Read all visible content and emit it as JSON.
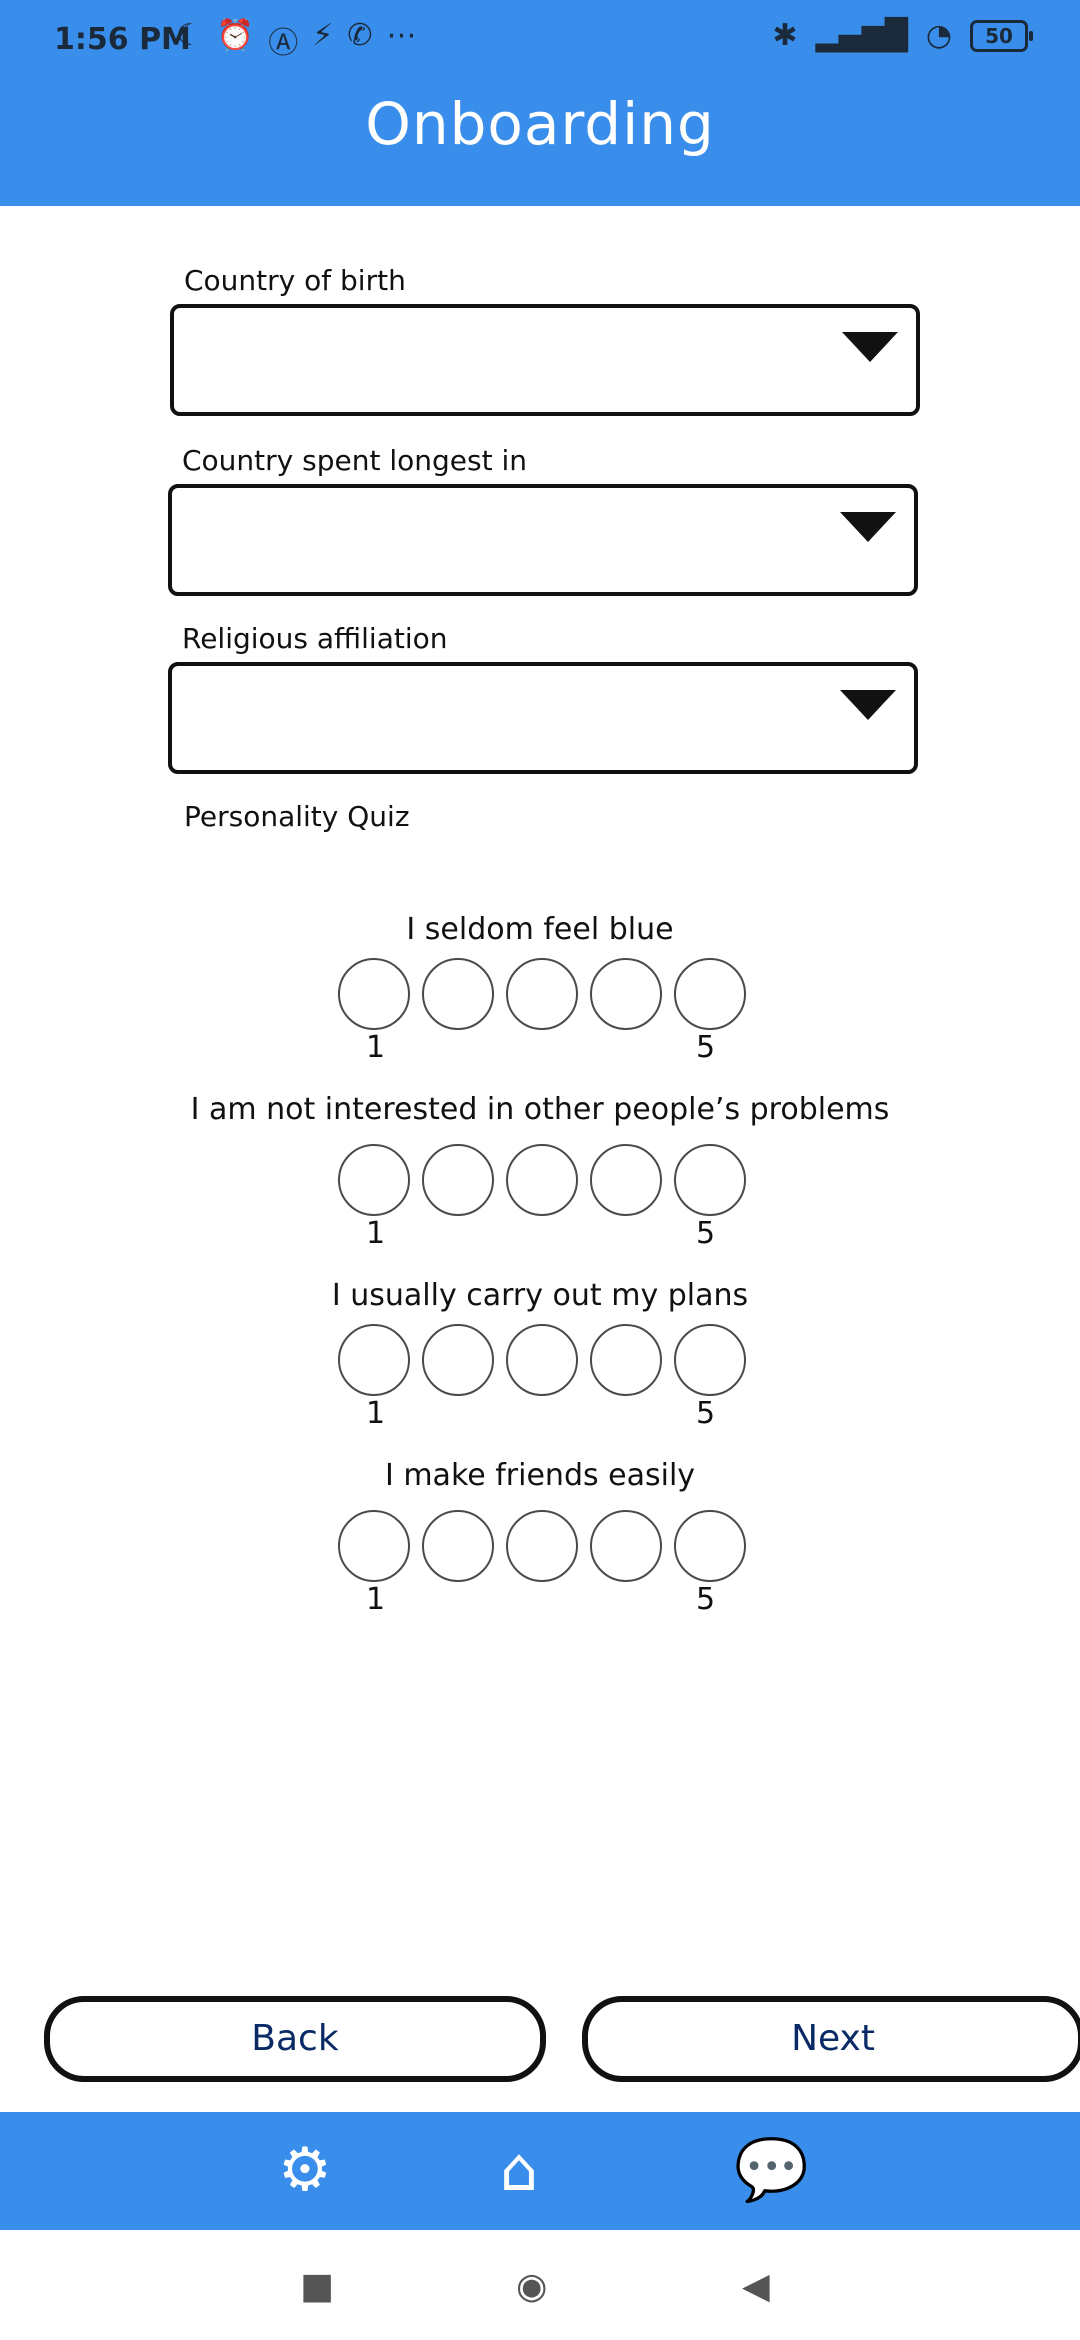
{
  "status_bar": {
    "time": "1:56 PM",
    "left_icons": [
      "moon-icon",
      "alarm-icon",
      "a-circle-icon",
      "hd-icon",
      "whatsapp-icon",
      "more-icon"
    ],
    "battery": "50"
  },
  "header": {
    "title": "Onboarding"
  },
  "form": {
    "country_of_birth_label": "Country of birth",
    "country_longest_label": "Country spent longest in",
    "religious_affiliation_label": "Religious affiliation"
  },
  "quiz": {
    "title": "Personality Quiz",
    "items": [
      {
        "question": "I seldom feel blue",
        "min_label": "1",
        "max_label": "5"
      },
      {
        "question": "I am not interested in other people’s problems",
        "min_label": "1",
        "max_label": "5"
      },
      {
        "question": "I usually carry out my plans",
        "min_label": "1",
        "max_label": "5"
      },
      {
        "question": "I make friends easily",
        "min_label": "1",
        "max_label": "5"
      }
    ]
  },
  "buttons": {
    "back": "Back",
    "next": "Next"
  },
  "bottom_nav": {
    "icons": [
      "gear-icon",
      "home-icon",
      "chat-icon"
    ]
  },
  "system_nav": {
    "icons": [
      "square-icon",
      "circle-icon",
      "back-triangle-icon"
    ]
  },
  "colors": {
    "primary": "#3a8eeb",
    "text": "#111111",
    "button_text": "#0a2a66"
  }
}
